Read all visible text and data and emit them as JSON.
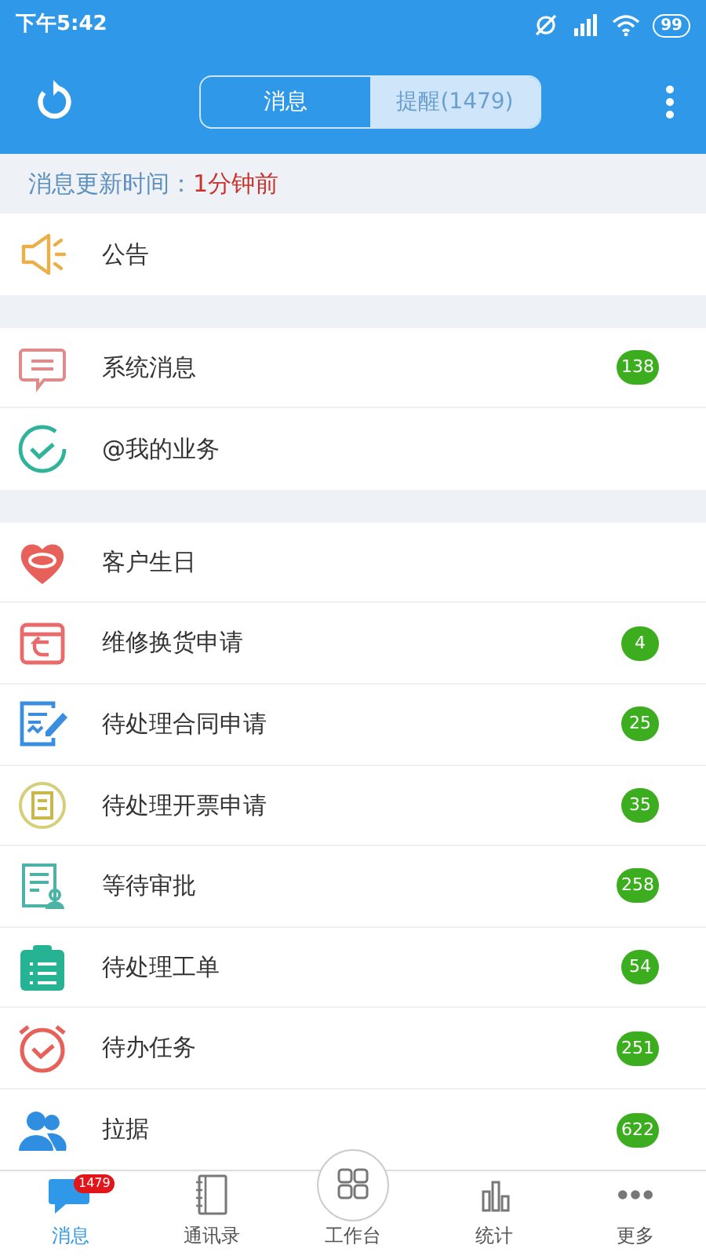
{
  "status_bar": {
    "time": "下午5:42",
    "battery": "99"
  },
  "header": {
    "tabs": [
      {
        "label": "消息",
        "selected": false
      },
      {
        "label": "提醒(1479)",
        "selected": true
      }
    ]
  },
  "update_bar": {
    "label": "消息更新时间：",
    "value": "1分钟前"
  },
  "groups": [
    {
      "items": [
        {
          "kind": "announcement",
          "label": "公告"
        }
      ]
    },
    {
      "items": [
        {
          "kind": "message",
          "label": "系统消息",
          "badge": "138"
        },
        {
          "kind": "business",
          "label": "@我的业务"
        }
      ]
    },
    {
      "items": [
        {
          "kind": "birthday",
          "label": "客户生日"
        },
        {
          "kind": "repair",
          "label": "维修换货申请",
          "badge": "4"
        },
        {
          "kind": "contract",
          "label": "待处理合同申请",
          "badge": "25"
        },
        {
          "kind": "invoice",
          "label": "待处理开票申请",
          "badge": "35"
        },
        {
          "kind": "approval",
          "label": "等待审批",
          "badge": "258"
        },
        {
          "kind": "workorder",
          "label": "待处理工单",
          "badge": "54"
        },
        {
          "kind": "task",
          "label": "待办任务",
          "badge": "251"
        },
        {
          "kind": "receipt",
          "label": "拉据",
          "badge": "622"
        }
      ]
    }
  ],
  "bottom_nav": [
    {
      "kind": "chat",
      "label": "消息",
      "badge": "1479",
      "selected": true
    },
    {
      "kind": "book",
      "label": "通讯录",
      "selected": false
    },
    {
      "kind": "grid",
      "label": "工作台",
      "selected": false
    },
    {
      "kind": "chart",
      "label": "统计",
      "selected": false
    },
    {
      "kind": "more",
      "label": "更多",
      "selected": false
    }
  ]
}
